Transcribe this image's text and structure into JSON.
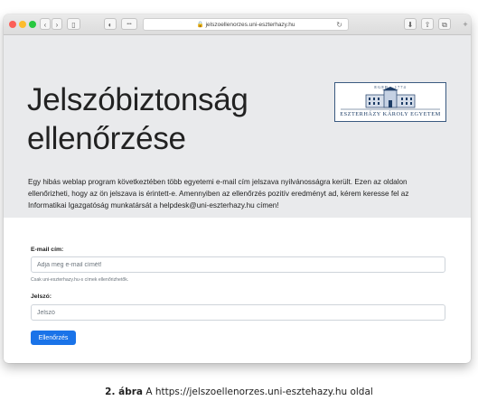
{
  "browser": {
    "url": "jelszoellenorzes.uni-eszterhazy.hu",
    "back_glyph": "‹",
    "forward_glyph": "›",
    "sidebar_glyph": "▯",
    "shield_glyph": "◐",
    "dots_glyph": "•••",
    "reload_glyph": "↻",
    "download_glyph": "⬇",
    "share_glyph": "⇧",
    "tabs_glyph": "⧉",
    "new_tab_glyph": "+"
  },
  "header": {
    "title_line1": "Jelszóbiztonság",
    "title_line2": "ellenőrzése",
    "logo_year": "EGER · 1774",
    "logo_text": "ESZTERHÁZY KÁROLY EGYETEM",
    "description": "Egy hibás weblap program következtében több egyetemi e-mail cím jelszava nyilvánosságra került. Ezen az oldalon ellenőrizheti, hogy az ön jelszava is érintett-e. Amennyiben az ellenőrzés pozitív eredményt ad, kérem keresse fel az Informatikai Igazgatóság munkatársát a helpdesk@uni-eszterhazy.hu címen!"
  },
  "form": {
    "email_label": "E-mail cím:",
    "email_placeholder": "Adja meg e-mail címét!",
    "email_help": "Csak uni-eszterhazy.hu-s címek ellenőrizhetők.",
    "password_label": "Jelszó:",
    "password_placeholder": "Jelszó",
    "submit_label": "Ellenőrzés"
  },
  "caption": {
    "figure_label": "2. ábra",
    "text": "A https://jelszoellenorzes.uni-esztehazy.hu oldal"
  },
  "colors": {
    "header_bg": "#e9eaec",
    "button_blue": "#1a73e8",
    "logo_blue": "#1d3d66"
  }
}
